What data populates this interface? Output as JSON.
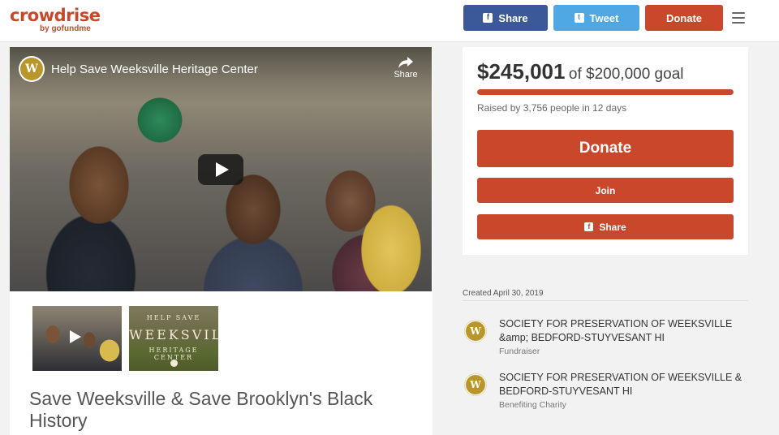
{
  "header": {
    "logo_main": "crowdrise",
    "logo_sub": "by gofundme",
    "share_label": "Share",
    "tweet_label": "Tweet",
    "donate_label": "Donate",
    "facebook_icon_glyph": "f",
    "twitter_icon_glyph": "t"
  },
  "video": {
    "title": "Help Save Weeksville Heritage Center",
    "share_label": "Share",
    "channel_initial": "W"
  },
  "thumbnails": [
    {
      "kind": "video"
    },
    {
      "kind": "image",
      "line1": "HELP SAVE",
      "line2": "WEEKSVILLE",
      "line3": "HERITAGE CENTER"
    }
  ],
  "campaign": {
    "title": "Save Weeksville & Save Brooklyn's Black History"
  },
  "fundraising": {
    "raised": "$245,001",
    "goal_text": "of $200,000 goal",
    "progress_fraction": 1.0,
    "raised_by": "Raised by 3,756 people in 12 days",
    "donate_label": "Donate",
    "join_label": "Join",
    "share_label": "Share"
  },
  "created": "Created April 30, 2019",
  "organizations": [
    {
      "name": "SOCIETY FOR PRESERVATION OF WEEKSVILLE &amp; BEDFORD-STUYVESANT HI",
      "role": "Fundraiser",
      "logo_initial": "W"
    },
    {
      "name": "SOCIETY FOR PRESERVATION OF WEEKSVILLE & BEDFORD-STUYVESANT HI",
      "role": "Benefiting Charity",
      "logo_initial": "W"
    }
  ],
  "colors": {
    "brand": "#c9482b",
    "facebook": "#3b5998",
    "twitter": "#4fa7e3",
    "org_gold": "#b8962c"
  }
}
